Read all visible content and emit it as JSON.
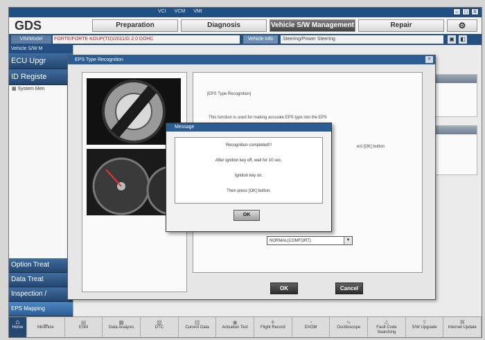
{
  "window": {
    "title_items": [
      "VCI",
      "VCM",
      "VMI"
    ],
    "controls": [
      "–",
      "□",
      "X"
    ]
  },
  "nav": {
    "logo": "GDS",
    "tabs": [
      "Preparation",
      "Diagnosis",
      "Vehicle S/W Management",
      "Repair"
    ],
    "help_icon": "help-icon"
  },
  "vehicle": {
    "vin_label": "VIN/Model",
    "vin_value": "FORTE/FORTE KOUP(TD)/2011/G 2.0 DOHC",
    "button_label": "Vehicle Info",
    "system": "Steering/Power Steering"
  },
  "sidebar": {
    "header": "Vehicle S/W M",
    "items_top": [
      "ECU Upgr",
      "ID Registe"
    ],
    "system_item": "System Men",
    "items_bottom": [
      "Option Treat",
      "Data Treat",
      "Inspection /",
      "EPS Mapping Initialization"
    ]
  },
  "dialog": {
    "title": "EPS Type Recognition",
    "heading": "[EPS Type Recognition]",
    "description": "This function is used for making accurate EPS type into the EPS",
    "partial_text": "ect [OK] button",
    "select_value": "NORMAL(COMFORT)",
    "ok_label": "OK",
    "cancel_label": "Cancel"
  },
  "message": {
    "title": "Message",
    "lines": [
      "Recognition completed!!!",
      "After ignition key off, wait for 10 sec.",
      "Ignition key on.",
      "Then press [OK] button."
    ],
    "ok_label": "OK"
  },
  "toolbar": {
    "items": [
      "Home",
      "Minimize",
      "ESM",
      "Data Analysis",
      "DTC",
      "Current Data",
      "Actuation Test",
      "Flight Record",
      "DVOM",
      "Oscilloscope",
      "Fault Code Searching",
      "S/W Upgrade",
      "Internet Update"
    ]
  }
}
